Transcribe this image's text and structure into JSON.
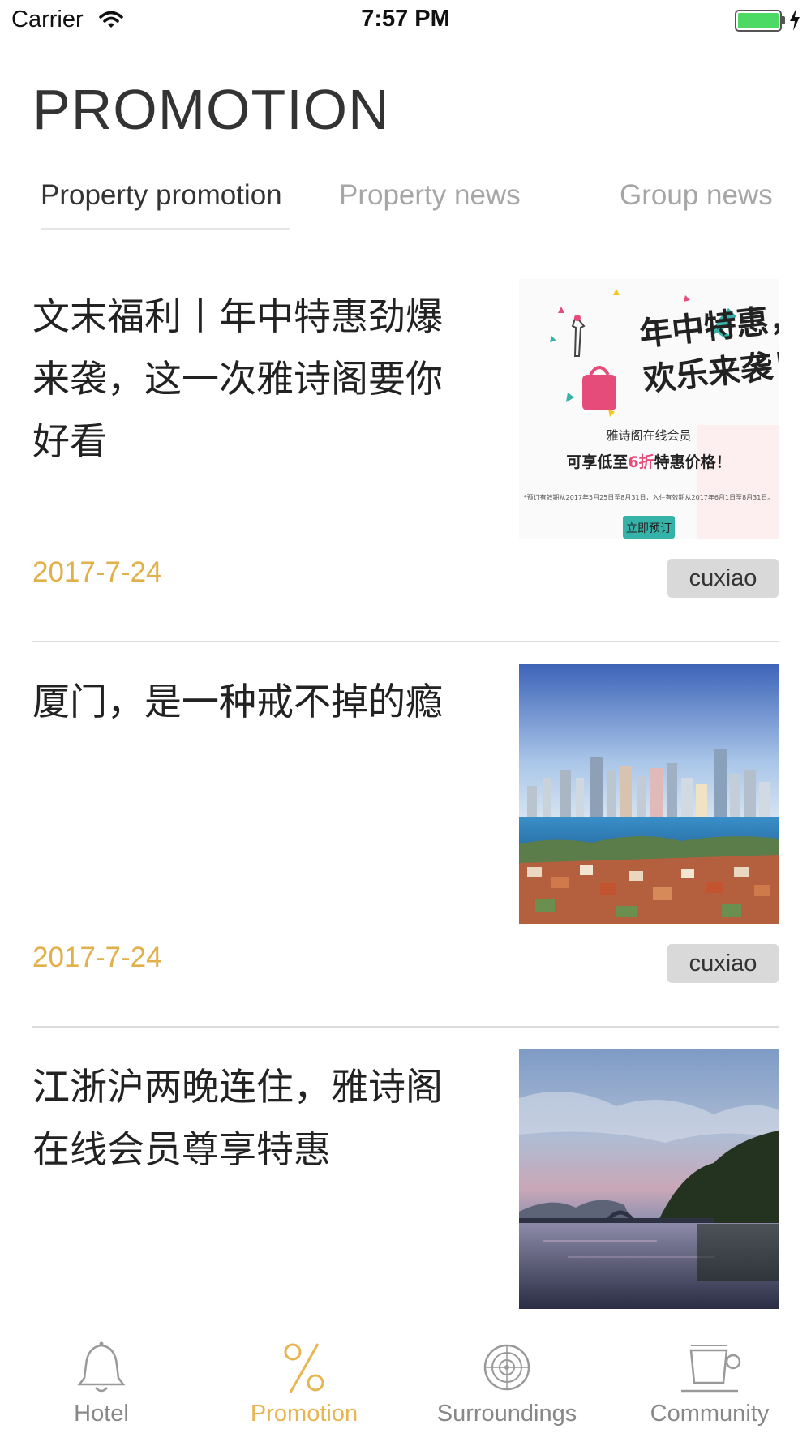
{
  "status_bar": {
    "carrier": "Carrier",
    "time": "7:57 PM"
  },
  "header": {
    "title": "PROMOTION"
  },
  "tabs": [
    {
      "label": "Property promotion",
      "active": true
    },
    {
      "label": "Property news",
      "active": false
    },
    {
      "label": "Group news",
      "active": false
    }
  ],
  "articles": [
    {
      "title": "文末福利丨年中特惠劲爆来袭，这一次雅诗阁要你好看",
      "date": "2017-7-24",
      "tag": "cuxiao",
      "image": {
        "headline_1": "年中特惠，",
        "headline_2": "欢乐来袭！",
        "member_line": "雅诗阁在线会员",
        "offer_prefix": "可享低至",
        "offer_highlight": "6折",
        "offer_suffix": "特惠价格！",
        "fine_print": "*预订有效期从2017年5月25日至8月31日，入住有效期从2017年6月1日至8月31日。",
        "button": "立即预订"
      }
    },
    {
      "title": "厦门，是一种戒不掉的瘾",
      "date": "2017-7-24",
      "tag": "cuxiao"
    },
    {
      "title": "江浙沪两晚连住，雅诗阁在线会员尊享特惠",
      "date": "",
      "tag": ""
    }
  ],
  "tab_bar": [
    {
      "label": "Hotel",
      "icon": "bell-icon",
      "active": false
    },
    {
      "label": "Promotion",
      "icon": "percent-icon",
      "active": true
    },
    {
      "label": "Surroundings",
      "icon": "radar-icon",
      "active": false
    },
    {
      "label": "Community",
      "icon": "coffee-cup-icon",
      "active": false
    }
  ],
  "colors": {
    "accent": "#e8b553",
    "date": "#e2b04a",
    "inactive_text": "#888888",
    "battery": "#4cd964"
  }
}
